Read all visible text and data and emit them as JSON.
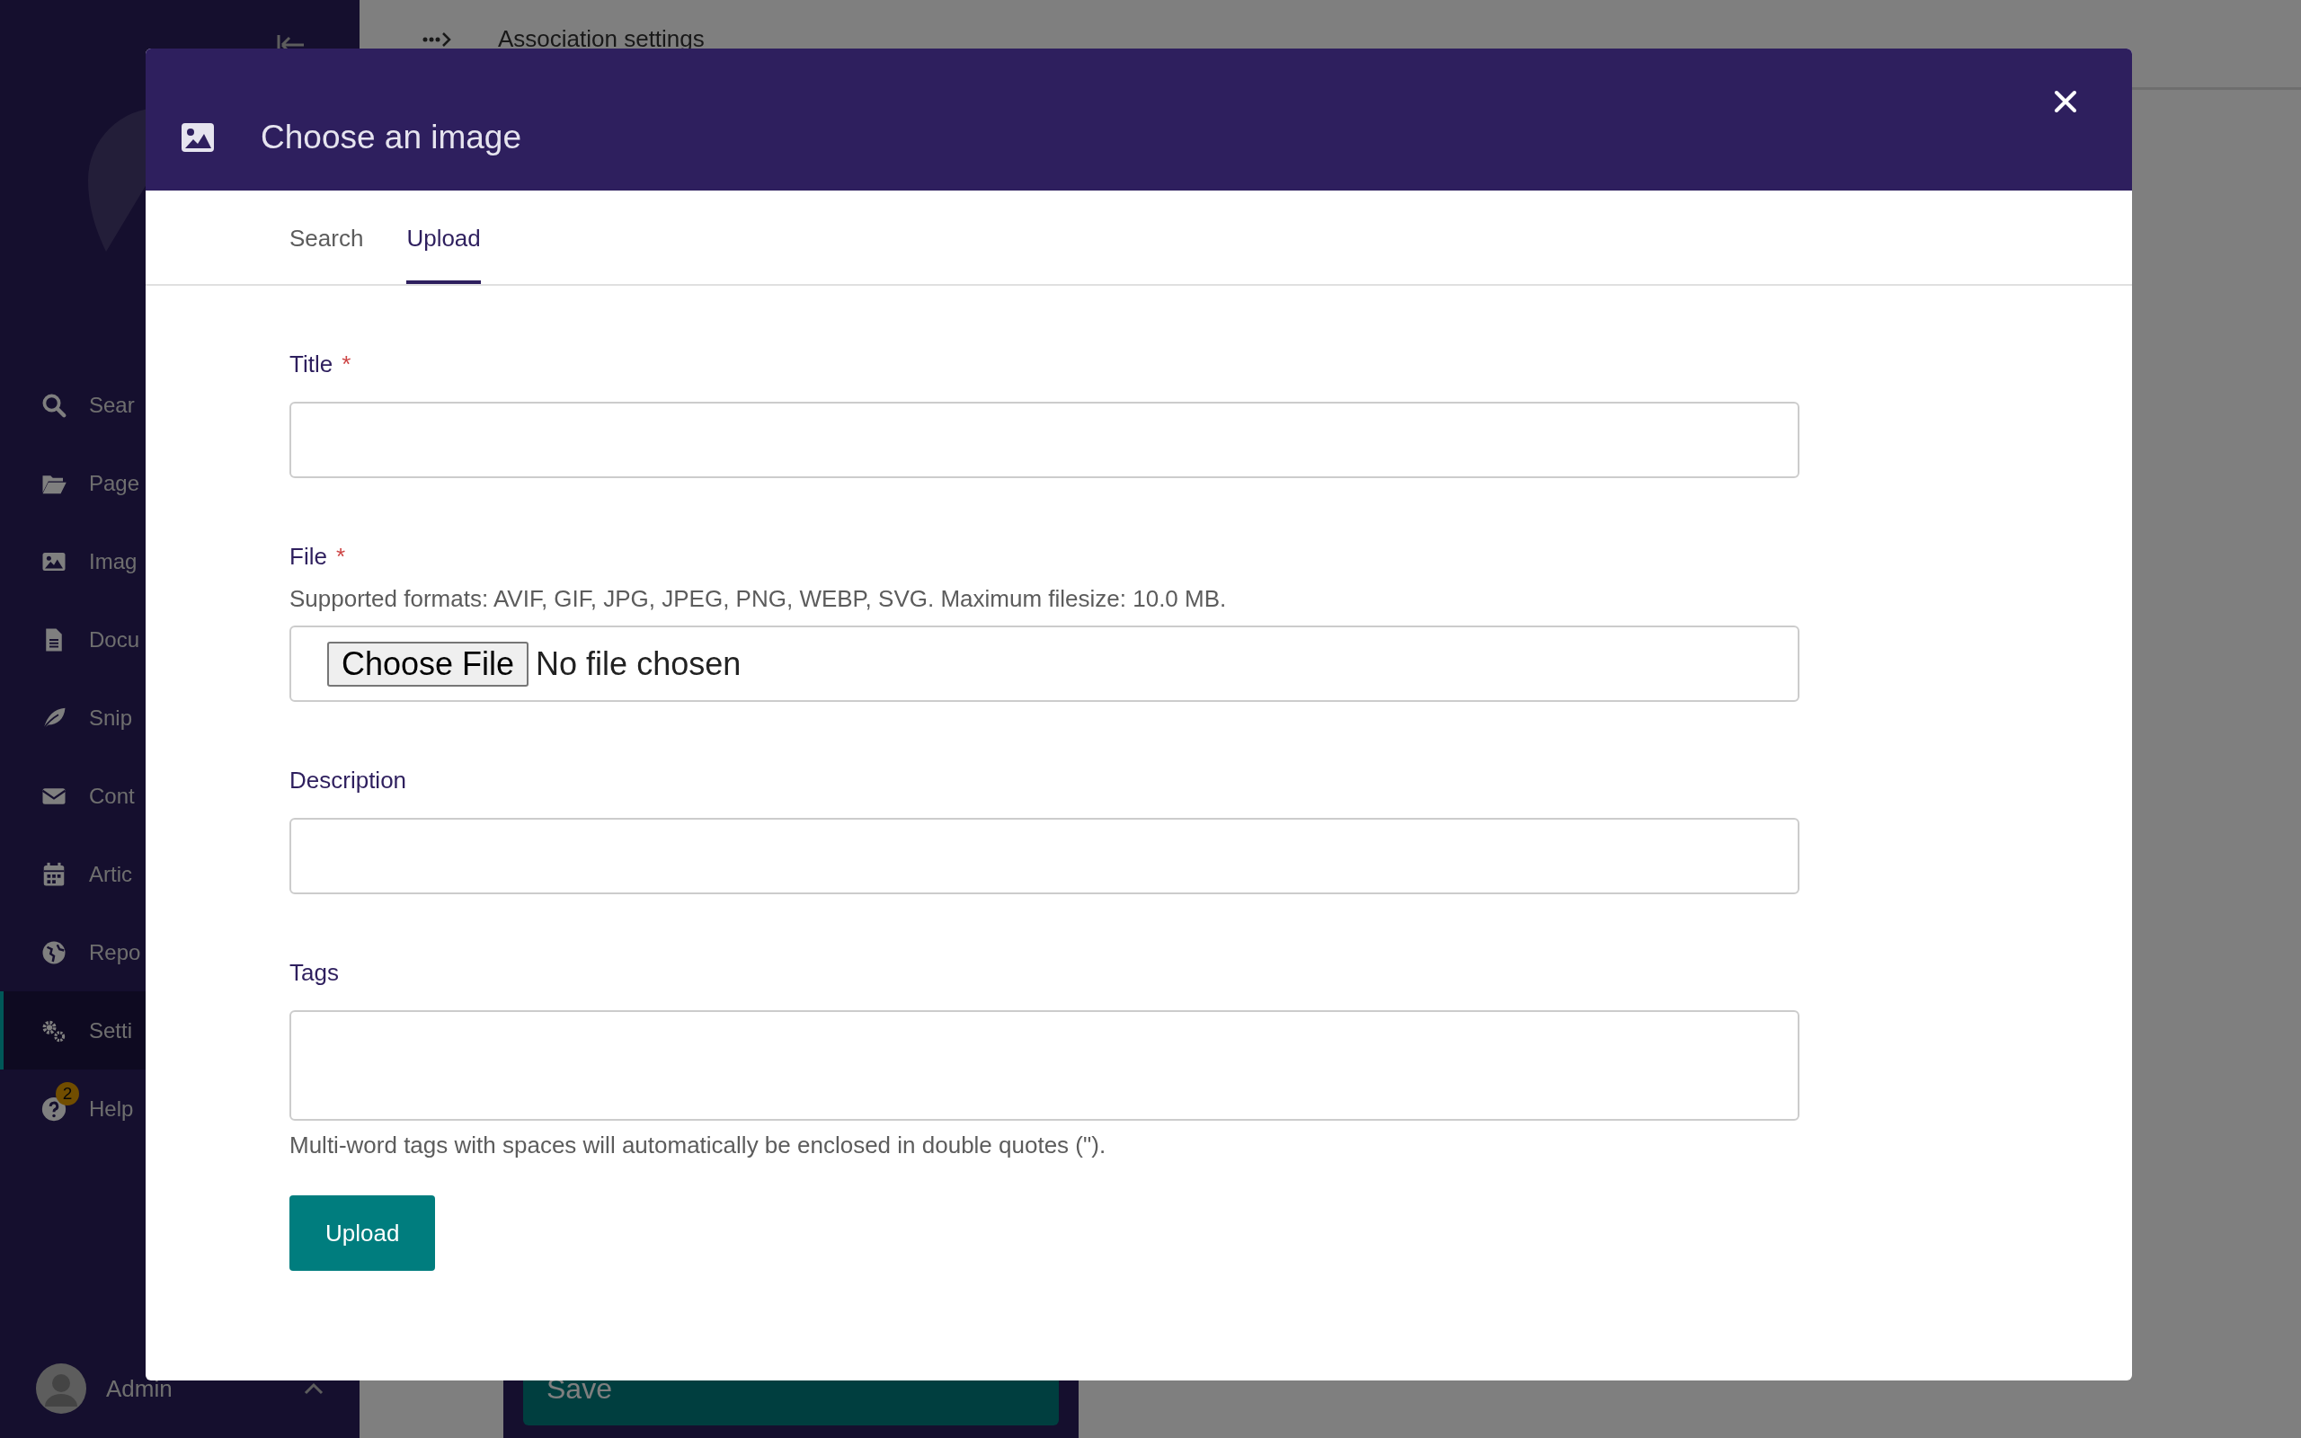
{
  "sidebar": {
    "items": [
      {
        "label": "Sear",
        "selected": false
      },
      {
        "label": "Page",
        "selected": false
      },
      {
        "label": "Imag",
        "selected": false
      },
      {
        "label": "Docu",
        "selected": false
      },
      {
        "label": "Snip",
        "selected": false
      },
      {
        "label": "Cont",
        "selected": false
      },
      {
        "label": "Artic",
        "selected": false
      },
      {
        "label": "Repo",
        "selected": false
      },
      {
        "label": "Setti",
        "selected": true
      },
      {
        "label": "Help",
        "selected": false,
        "badge": "2"
      }
    ],
    "user": {
      "name": "Admin"
    }
  },
  "page": {
    "breadcrumb": "Association settings",
    "save_button": "Save"
  },
  "modal": {
    "title": "Choose an image",
    "tabs": [
      {
        "label": "Search",
        "selected": false
      },
      {
        "label": "Upload",
        "selected": true
      }
    ],
    "fields": [
      {
        "kind": "text",
        "label": "Title",
        "required_mark": "*"
      },
      {
        "kind": "file",
        "label": "File",
        "required_mark": "*",
        "help": "Supported formats: AVIF, GIF, JPG, JPEG, PNG, WEBP, SVG. Maximum filesize: 10.0 MB.",
        "button": "Choose File",
        "status": "No file chosen"
      },
      {
        "kind": "text",
        "label": "Description"
      },
      {
        "kind": "textarea",
        "label": "Tags",
        "note": "Multi-word tags with spaces will automatically be enclosed in double quotes (\")."
      }
    ],
    "submit": "Upload"
  }
}
